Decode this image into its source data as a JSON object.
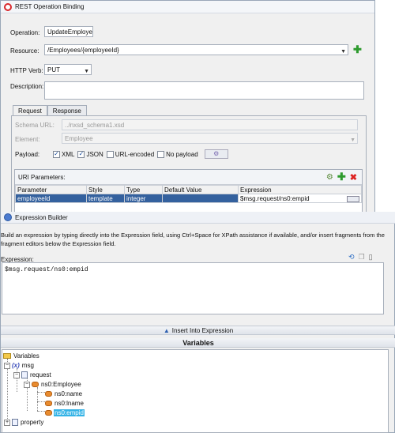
{
  "binding_dialog": {
    "title": "REST Operation Binding",
    "operation_label": "Operation:",
    "operation_value": "UpdateEmployee",
    "resource_label": "Resource:",
    "resource_value": "/Employees/{employeeId}",
    "http_verb_label": "HTTP Verb:",
    "http_verb_value": "PUT",
    "description_label": "Description:",
    "description_value": "",
    "tabs": [
      "Request",
      "Response"
    ],
    "schema_url_label": "Schema URL:",
    "schema_url_value": "../nxsd_schema1.xsd",
    "element_label": "Element:",
    "element_value": "Employee",
    "payload_label": "Payload:",
    "payload_options": [
      {
        "label": "XML",
        "checked": true
      },
      {
        "label": "JSON",
        "checked": true
      },
      {
        "label": "URL-encoded",
        "checked": false
      },
      {
        "label": "No payload",
        "checked": false
      }
    ],
    "uri_parameters": {
      "title": "URI Parameters:",
      "columns": [
        "Parameter",
        "Style",
        "Type",
        "Default Value",
        "Expression"
      ],
      "rows": [
        [
          "employeeId",
          "template",
          "integer",
          "",
          "$msg.request/ns0:empid"
        ]
      ]
    }
  },
  "expression_builder": {
    "title": "Expression Builder",
    "instructions": "Build an expression by typing directly into the Expression field, using Ctrl+Space for XPath assistance if available, and/or insert fragments from the fragment editors below the Expression field.",
    "expression_label": "Expression:",
    "expression_value": "$msg.request/ns0:empid",
    "insert_label": "Insert Into Expression",
    "variables_header": "Variables",
    "tree": {
      "root": "Variables",
      "msg": "msg",
      "request": "request",
      "employee": "ns0:Employee",
      "name": "ns0:name",
      "lname": "ns0:lname",
      "empid": "ns0:empid",
      "property": "property"
    }
  }
}
